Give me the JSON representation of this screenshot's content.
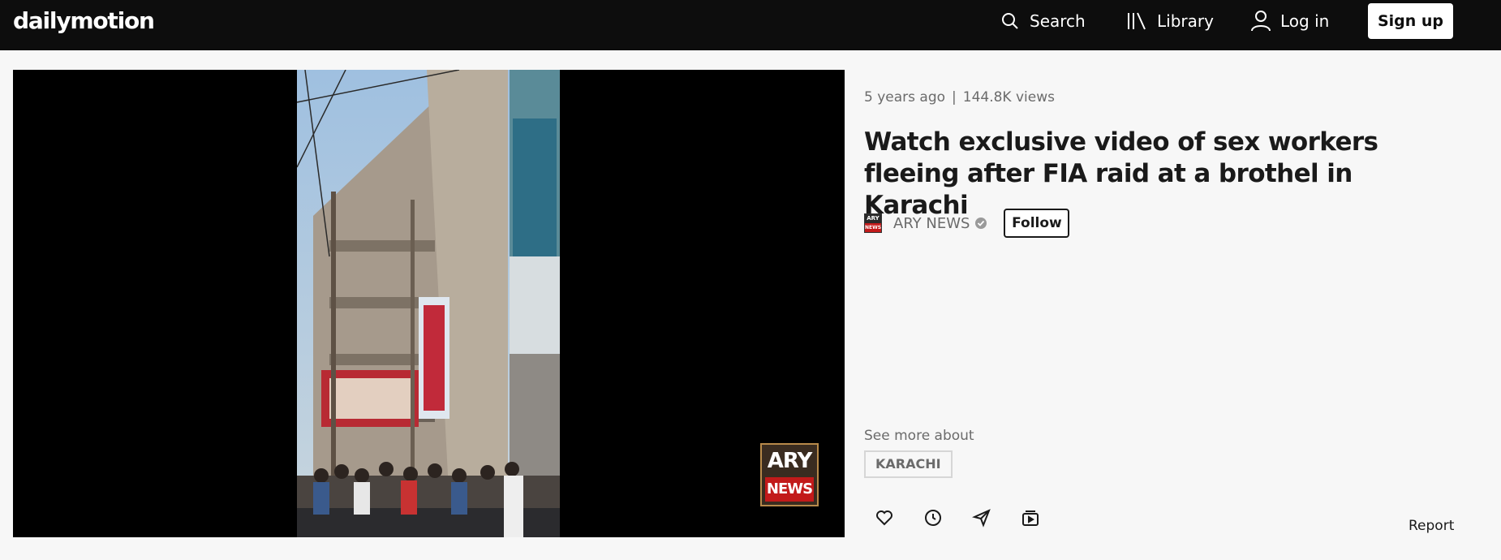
{
  "header": {
    "logo": "dailymotion",
    "nav": {
      "search_label": "Search",
      "library_label": "Library",
      "login_label": "Log in"
    },
    "signup_label": "Sign up"
  },
  "video": {
    "watermark": {
      "line1": "ARY",
      "line2": "NEWS"
    }
  },
  "info": {
    "age": "5 years ago",
    "separator": "|",
    "views": "144.8K views",
    "title": "Watch exclusive video of sex workers fleeing after FIA raid at a brothel in Karachi",
    "channel": {
      "avatar_line1": "ARY",
      "avatar_line2": "NEWS",
      "name": "ARY NEWS",
      "follow_label": "Follow"
    },
    "see_more_label": "See more about",
    "tags": [
      "KARACHI"
    ],
    "actions": [
      "heart-icon",
      "clock-icon",
      "share-icon",
      "playlist-icon"
    ],
    "report_label": "Report"
  },
  "colors": {
    "header_bg": "#0d0d0d",
    "page_bg": "#f7f7f7",
    "ary_red": "#c21a1a"
  }
}
